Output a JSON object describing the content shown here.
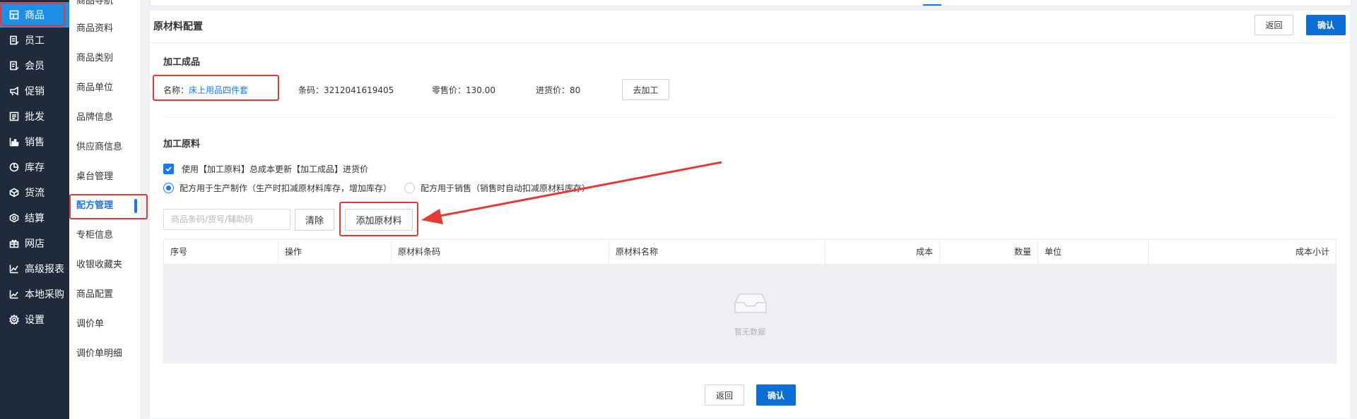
{
  "nav_primary": {
    "items": [
      {
        "label": "商品",
        "icon": "grid-icon",
        "active": true
      },
      {
        "label": "员工",
        "icon": "badge-icon"
      },
      {
        "label": "会员",
        "icon": "member-card-icon"
      },
      {
        "label": "促销",
        "icon": "megaphone-icon"
      },
      {
        "label": "批发",
        "icon": "list-icon"
      },
      {
        "label": "销售",
        "icon": "bar-chart-icon"
      },
      {
        "label": "库存",
        "icon": "pie-chart-icon"
      },
      {
        "label": "货流",
        "icon": "box-icon"
      },
      {
        "label": "结算",
        "icon": "settle-icon"
      },
      {
        "label": "网店",
        "icon": "gift-icon"
      },
      {
        "label": "高级报表",
        "icon": "line-chart-icon"
      },
      {
        "label": "本地采购",
        "icon": "trend-icon"
      },
      {
        "label": "设置",
        "icon": "gear-icon"
      }
    ]
  },
  "nav_secondary": {
    "items": [
      {
        "label": "商品导航"
      },
      {
        "label": "商品资料"
      },
      {
        "label": "商品类别"
      },
      {
        "label": "商品单位"
      },
      {
        "label": "品牌信息"
      },
      {
        "label": "供应商信息"
      },
      {
        "label": "桌台管理"
      },
      {
        "label": "配方管理",
        "active": true
      },
      {
        "label": "专柜信息"
      },
      {
        "label": "收银收藏夹"
      },
      {
        "label": "商品配置"
      },
      {
        "label": "调价单"
      },
      {
        "label": "调价单明细"
      }
    ]
  },
  "panel": {
    "title": "原材料配置",
    "back_label": "返回",
    "confirm_label": "确认"
  },
  "product": {
    "section_title": "加工成品",
    "name_label": "名称：",
    "name_value": "床上用品四件套",
    "barcode": "条码：3212041619405",
    "retail_price": "零售价：130.00",
    "purchase_price": "进货价：80",
    "process_button": "去加工"
  },
  "materials": {
    "section_title": "加工原料",
    "use_cost_checkbox": "使用【加工原料】总成本更新【加工成品】进货价",
    "radio_production": "配方用于生产制作（生产时扣减原材料库存，增加库存）",
    "radio_sales": "配方用于销售（销售时自动扣减原材料库存）",
    "search_placeholder": "商品条码/货号/辅助码",
    "clear_button": "清除",
    "add_button": "添加原材料"
  },
  "table": {
    "columns": [
      "序号",
      "操作",
      "原材料条码",
      "原材料名称",
      "成本",
      "数量",
      "单位",
      "成本小计"
    ],
    "empty_text": "暂无数据"
  },
  "footer": {
    "back_label": "返回",
    "confirm_label": "确认"
  },
  "colors": {
    "sidebar_bg": "#1f2a3b",
    "accent": "#1677ff",
    "annotation": "#e53935"
  }
}
